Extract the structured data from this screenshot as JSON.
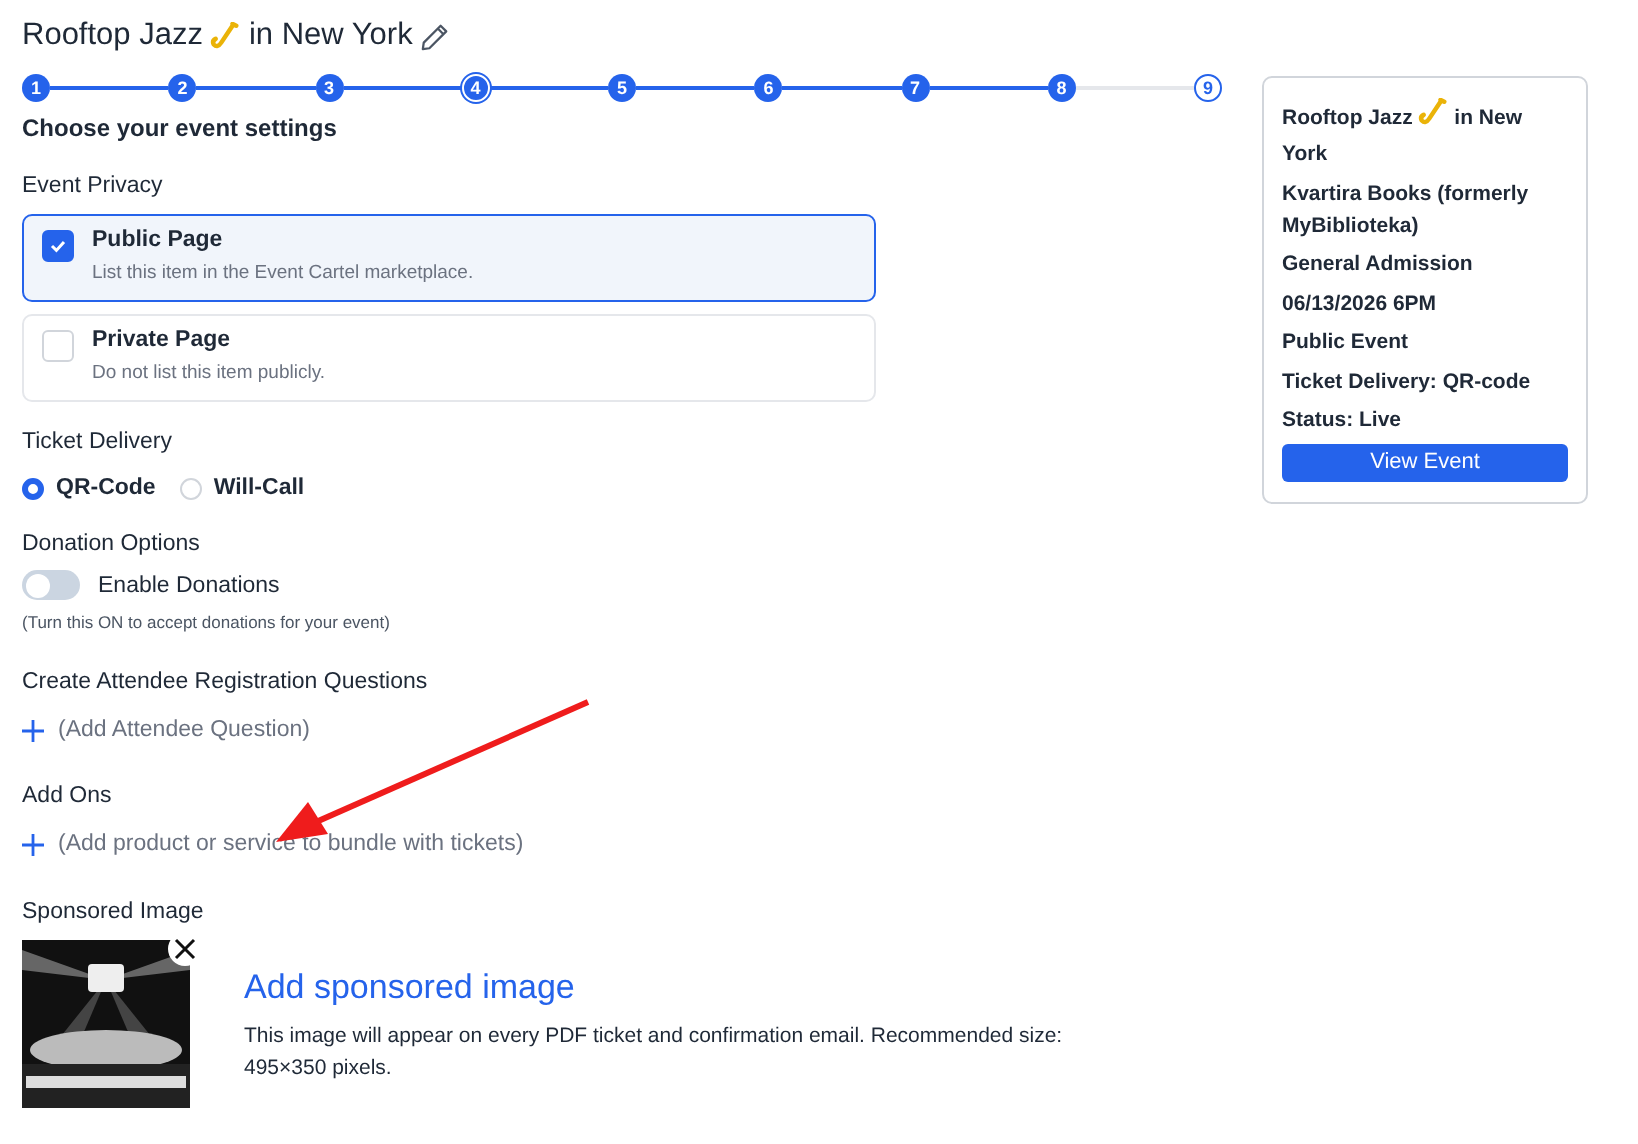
{
  "title": {
    "before": "Rooftop Jazz",
    "after": "in New York"
  },
  "steps": [
    {
      "label": "1",
      "done": true,
      "selected": false
    },
    {
      "label": "2",
      "done": true,
      "selected": false
    },
    {
      "label": "3",
      "done": true,
      "selected": false
    },
    {
      "label": "4",
      "done": true,
      "selected": true
    },
    {
      "label": "5",
      "done": true,
      "selected": false
    },
    {
      "label": "6",
      "done": true,
      "selected": false
    },
    {
      "label": "7",
      "done": true,
      "selected": false
    },
    {
      "label": "8",
      "done": true,
      "selected": false
    },
    {
      "label": "9",
      "done": false,
      "selected": false
    }
  ],
  "heading": "Choose your event settings",
  "privacy": {
    "label": "Event Privacy",
    "options": [
      {
        "title": "Public Page",
        "description": "List this item in the Event Cartel marketplace.",
        "selected": true
      },
      {
        "title": "Private Page",
        "description": "Do not list this item publicly.",
        "selected": false
      }
    ]
  },
  "ticket_delivery": {
    "label": "Ticket Delivery",
    "options": [
      {
        "label": "QR-Code",
        "selected": true
      },
      {
        "label": "Will-Call",
        "selected": false
      }
    ]
  },
  "donations": {
    "label": "Donation Options",
    "toggle": "Enable Donations",
    "on": false,
    "hint": "(Turn this ON to accept donations for your event)"
  },
  "questions": {
    "label": "Create Attendee Registration Questions",
    "action": "(Add Attendee Question)"
  },
  "add_ons": {
    "label": "Add Ons",
    "action": "(Add product or service to bundle with tickets)"
  },
  "sponsored": {
    "label": "Sponsored Image",
    "link": "Add sponsored image",
    "description": "This image will appear on every PDF ticket and confirmation email. Recommended size: 495×350 pixels."
  },
  "summary": {
    "title": {
      "before": "Rooftop Jazz",
      "after": "in New York"
    },
    "lines": [
      "Kvartira Books (formerly MyBiblioteka)",
      "General Admission",
      "06/13/2026 6PM",
      "Public Event",
      "Ticket Delivery: QR-code",
      "Status: Live"
    ],
    "button": "View Event"
  }
}
